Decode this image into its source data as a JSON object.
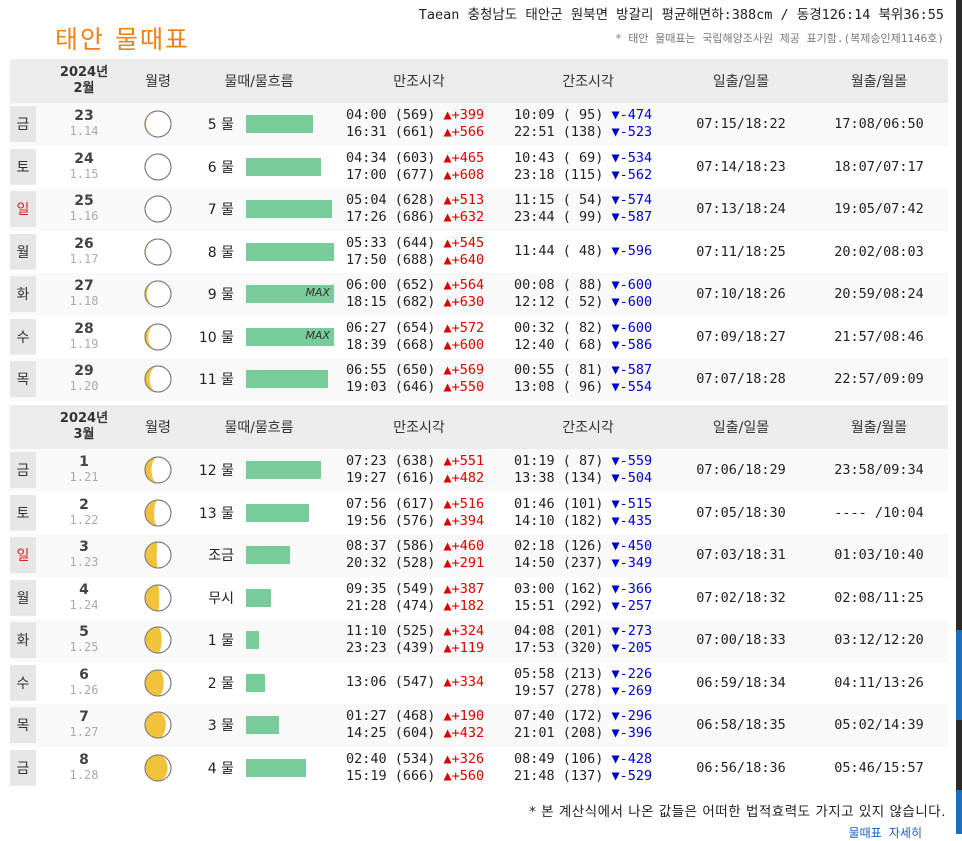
{
  "title": "태안 물때표",
  "location": "Taean 충청남도 태안군 원북면 방갈리 평균해면하:388cm / 동경126:14 북위36:55",
  "source_note": "* 태안 물때표는 국립해양조사원 제공 표기함.(복제승인제1146호)",
  "headers": {
    "moon": "월령",
    "mul": "물때/물흐름",
    "high": "만조시각",
    "low": "간조시각",
    "sun": "일출/일몰",
    "moonrise": "월출/월몰"
  },
  "months": [
    {
      "year": "2024년",
      "month": "2월",
      "rows": [
        {
          "day": "금",
          "date": "23",
          "lunar": "1.14",
          "mul": "5 물",
          "flow": 0.7,
          "max": "",
          "high": [
            "04:00 (569)",
            "16:31 (661)"
          ],
          "hd": [
            "+399",
            "+566"
          ],
          "low": [
            "10:09 ( 95)",
            "22:51 (138)"
          ],
          "ld": [
            "-474",
            "-523"
          ],
          "sun": "07:15/18:22",
          "moon": "17:08/06:50",
          "phase": 0.96
        },
        {
          "day": "토",
          "date": "24",
          "lunar": "1.15",
          "mul": "6 물",
          "flow": 0.78,
          "max": "",
          "high": [
            "04:34 (603)",
            "17:00 (677)"
          ],
          "hd": [
            "+465",
            "+608"
          ],
          "low": [
            "10:43 ( 69)",
            "23:18 (115)"
          ],
          "ld": [
            "-534",
            "-562"
          ],
          "sun": "07:14/18:23",
          "moon": "18:07/07:17",
          "phase": 1.0
        },
        {
          "day": "일",
          "date": "25",
          "lunar": "1.16",
          "mul": "7 물",
          "flow": 0.9,
          "max": "",
          "high": [
            "05:04 (628)",
            "17:26 (686)"
          ],
          "hd": [
            "+513",
            "+632"
          ],
          "low": [
            "11:15 ( 54)",
            "23:44 ( 99)"
          ],
          "ld": [
            "-574",
            "-587"
          ],
          "sun": "07:13/18:24",
          "moon": "19:05/07:42",
          "phase": 1.0
        },
        {
          "day": "월",
          "date": "26",
          "lunar": "1.17",
          "mul": "8 물",
          "flow": 0.92,
          "max": "",
          "high": [
            "05:33 (644)",
            "17:50 (688)"
          ],
          "hd": [
            "+545",
            "+640"
          ],
          "low": [
            "11:44 ( 48)",
            ""
          ],
          "ld": [
            "-596",
            ""
          ],
          "sun": "07:11/18:25",
          "moon": "20:02/08:03",
          "phase": 0.97
        },
        {
          "day": "화",
          "date": "27",
          "lunar": "1.18",
          "mul": "9 물",
          "flow": 0.92,
          "max": "MAX",
          "high": [
            "06:00 (652)",
            "18:15 (682)"
          ],
          "hd": [
            "+564",
            "+630"
          ],
          "low": [
            "00:08 ( 88)",
            "12:12 ( 52)"
          ],
          "ld": [
            "-600",
            "-600"
          ],
          "sun": "07:10/18:26",
          "moon": "20:59/08:24",
          "phase": 0.93
        },
        {
          "day": "수",
          "date": "28",
          "lunar": "1.19",
          "mul": "10 물",
          "flow": 0.92,
          "max": "MAX",
          "high": [
            "06:27 (654)",
            "18:39 (668)"
          ],
          "hd": [
            "+572",
            "+600"
          ],
          "low": [
            "00:32 ( 82)",
            "12:40 ( 68)"
          ],
          "ld": [
            "-600",
            "-586"
          ],
          "sun": "07:09/18:27",
          "moon": "21:57/08:46",
          "phase": 0.88
        },
        {
          "day": "목",
          "date": "29",
          "lunar": "1.20",
          "mul": "11 물",
          "flow": 0.85,
          "max": "",
          "high": [
            "06:55 (650)",
            "19:03 (646)"
          ],
          "hd": [
            "+569",
            "+550"
          ],
          "low": [
            "00:55 ( 81)",
            "13:08 ( 96)"
          ],
          "ld": [
            "-587",
            "-554"
          ],
          "sun": "07:07/18:28",
          "moon": "22:57/09:09",
          "phase": 0.82
        }
      ]
    },
    {
      "year": "2024년",
      "month": "3월",
      "rows": [
        {
          "day": "금",
          "date": "1",
          "lunar": "1.21",
          "mul": "12 물",
          "flow": 0.78,
          "max": "",
          "high": [
            "07:23 (638)",
            "19:27 (616)"
          ],
          "hd": [
            "+551",
            "+482"
          ],
          "low": [
            "01:19 ( 87)",
            "13:38 (134)"
          ],
          "ld": [
            "-559",
            "-504"
          ],
          "sun": "07:06/18:29",
          "moon": "23:58/09:34",
          "phase": 0.75
        },
        {
          "day": "토",
          "date": "2",
          "lunar": "1.22",
          "mul": "13 물",
          "flow": 0.66,
          "max": "",
          "high": [
            "07:56 (617)",
            "19:56 (576)"
          ],
          "hd": [
            "+516",
            "+394"
          ],
          "low": [
            "01:46 (101)",
            "14:10 (182)"
          ],
          "ld": [
            "-515",
            "-435"
          ],
          "sun": "07:05/18:30",
          "moon": "---- /10:04",
          "phase": 0.65
        },
        {
          "day": "일",
          "date": "3",
          "lunar": "1.23",
          "mul": "조금",
          "flow": 0.46,
          "max": "",
          "high": [
            "08:37 (586)",
            "20:32 (528)"
          ],
          "hd": [
            "+460",
            "+291"
          ],
          "low": [
            "02:18 (126)",
            "14:50 (237)"
          ],
          "ld": [
            "-450",
            "-349"
          ],
          "sun": "07:03/18:31",
          "moon": "01:03/10:40",
          "phase": 0.55
        },
        {
          "day": "월",
          "date": "4",
          "lunar": "1.24",
          "mul": "무시",
          "flow": 0.26,
          "max": "",
          "high": [
            "09:35 (549)",
            "21:28 (474)"
          ],
          "hd": [
            "+387",
            "+182"
          ],
          "low": [
            "03:00 (162)",
            "15:51 (292)"
          ],
          "ld": [
            "-366",
            "-257"
          ],
          "sun": "07:02/18:32",
          "moon": "02:08/11:25",
          "phase": 0.45
        },
        {
          "day": "화",
          "date": "5",
          "lunar": "1.25",
          "mul": "1 물",
          "flow": 0.14,
          "max": "",
          "high": [
            "11:10 (525)",
            "23:23 (439)"
          ],
          "hd": [
            "+324",
            "+119"
          ],
          "low": [
            "04:08 (201)",
            "17:53 (320)"
          ],
          "ld": [
            "-273",
            "-205"
          ],
          "sun": "07:00/18:33",
          "moon": "03:12/12:20",
          "phase": 0.36
        },
        {
          "day": "수",
          "date": "6",
          "lunar": "1.26",
          "mul": "2 물",
          "flow": 0.2,
          "max": "",
          "high": [
            "13:06 (547)",
            ""
          ],
          "hd": [
            "+334",
            ""
          ],
          "low": [
            "05:58 (213)",
            "19:57 (278)"
          ],
          "ld": [
            "-226",
            "-269"
          ],
          "sun": "06:59/18:34",
          "moon": "04:11/13:26",
          "phase": 0.28
        },
        {
          "day": "목",
          "date": "7",
          "lunar": "1.27",
          "mul": "3 물",
          "flow": 0.34,
          "max": "",
          "high": [
            "01:27 (468)",
            "14:25 (604)"
          ],
          "hd": [
            "+190",
            "+432"
          ],
          "low": [
            "07:40 (172)",
            "21:01 (208)"
          ],
          "ld": [
            "-296",
            "-396"
          ],
          "sun": "06:58/18:35",
          "moon": "05:02/14:39",
          "phase": 0.2
        },
        {
          "day": "금",
          "date": "8",
          "lunar": "1.28",
          "mul": "4 물",
          "flow": 0.62,
          "max": "",
          "high": [
            "02:40 (534)",
            "15:19 (666)"
          ],
          "hd": [
            "+326",
            "+560"
          ],
          "low": [
            "08:49 (106)",
            "21:48 (137)"
          ],
          "ld": [
            "-428",
            "-529"
          ],
          "sun": "06:56/18:36",
          "moon": "05:46/15:57",
          "phase": 0.13
        }
      ]
    }
  ],
  "footer": "* 본 계산식에서 나온 값들은 어떠한 법적효력도 가지고 있지 않습니다.",
  "footer_link": "물때표 자세히",
  "colors": {
    "title": "#f08214",
    "bar": "#78cc9a",
    "rise": "#dd0000",
    "fall": "#0000c8",
    "sunday": "#dd2222"
  }
}
